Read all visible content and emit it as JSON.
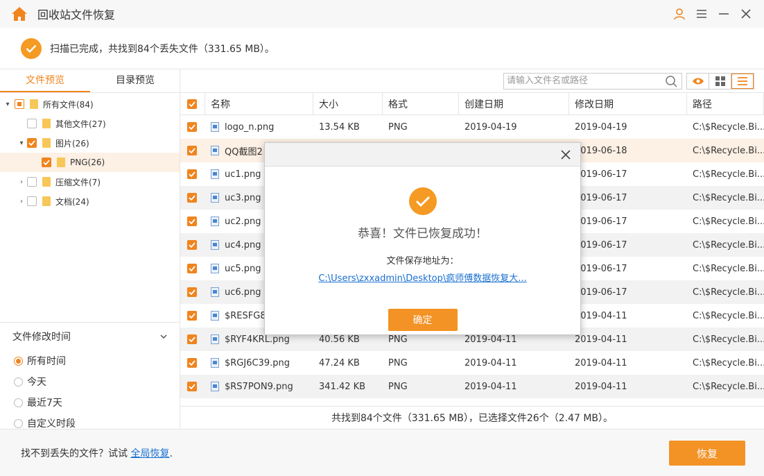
{
  "app": {
    "title": "回收站文件恢复"
  },
  "status": {
    "text": "扫描已完成，共找到84个丢失文件（331.65 MB）。"
  },
  "left_tabs": [
    "文件预览",
    "目录预览"
  ],
  "tree": [
    {
      "label": "所有文件(84)"
    },
    {
      "label": "其他文件(27)"
    },
    {
      "label": "图片(26)"
    },
    {
      "label": "PNG(26)"
    },
    {
      "label": "压缩文件(7)"
    },
    {
      "label": "文档(24)"
    }
  ],
  "filter": {
    "title": "文件修改时间",
    "options": [
      "所有时间",
      "今天",
      "最近7天",
      "自定义时段"
    ]
  },
  "search": {
    "placeholder": "请输入文件名或路径"
  },
  "columns": [
    "名称",
    "大小",
    "格式",
    "创建日期",
    "修改日期",
    "路径"
  ],
  "rows": [
    {
      "name": "logo_n.png",
      "size": "13.54 KB",
      "format": "PNG",
      "created": "2019-04-19",
      "modified": "2019-04-19",
      "path": "C:\\$Recycle.Bi..."
    },
    {
      "name": "QQ截图2",
      "size": "",
      "format": "",
      "created": "",
      "modified": "2019-06-18",
      "path": "C:\\$Recycle.Bi..."
    },
    {
      "name": "uc1.png",
      "size": "",
      "format": "",
      "created": "",
      "modified": "2019-06-17",
      "path": "C:\\$Recycle.Bi..."
    },
    {
      "name": "uc3.png",
      "size": "",
      "format": "",
      "created": "",
      "modified": "2019-06-17",
      "path": "C:\\$Recycle.Bi..."
    },
    {
      "name": "uc2.png",
      "size": "",
      "format": "",
      "created": "",
      "modified": "2019-06-17",
      "path": "C:\\$Recycle.Bi..."
    },
    {
      "name": "uc4.png",
      "size": "",
      "format": "",
      "created": "",
      "modified": "2019-06-17",
      "path": "C:\\$Recycle.Bi..."
    },
    {
      "name": "uc5.png",
      "size": "",
      "format": "",
      "created": "",
      "modified": "2019-06-17",
      "path": "C:\\$Recycle.Bi..."
    },
    {
      "name": "uc6.png",
      "size": "",
      "format": "",
      "created": "",
      "modified": "2019-06-17",
      "path": "C:\\$Recycle.Bi..."
    },
    {
      "name": "$RESFG8",
      "size": "",
      "format": "",
      "created": "",
      "modified": "2019-04-11",
      "path": "C:\\$Recycle.Bi..."
    },
    {
      "name": "$RYF4KRL.png",
      "size": "40.56 KB",
      "format": "PNG",
      "created": "2019-04-11",
      "modified": "2019-04-11",
      "path": "C:\\$Recycle.Bi..."
    },
    {
      "name": "$RGJ6C39.png",
      "size": "47.24 KB",
      "format": "PNG",
      "created": "2019-04-11",
      "modified": "2019-04-11",
      "path": "C:\\$Recycle.Bi..."
    },
    {
      "name": "$RS7PON9.png",
      "size": "341.42 KB",
      "format": "PNG",
      "created": "2019-04-11",
      "modified": "2019-04-11",
      "path": "C:\\$Recycle.Bi..."
    }
  ],
  "summary": "共找到84个文件（331.65 MB），已选择文件26个（2.47 MB）。",
  "footer": {
    "hint": "找不到丢失的文件？试试",
    "link": "全局恢复",
    "hint_tail": ".",
    "recover": "恢复"
  },
  "modal": {
    "title": "恭喜！文件已恢复成功！",
    "label": "文件保存地址为：",
    "path": "C:\\Users\\zxxadmin\\Desktop\\疯师傅数据恢复大...",
    "ok": "确定"
  },
  "colors": {
    "accent": "#f0841e",
    "button": "#f39225",
    "link": "#1a6fd1"
  }
}
